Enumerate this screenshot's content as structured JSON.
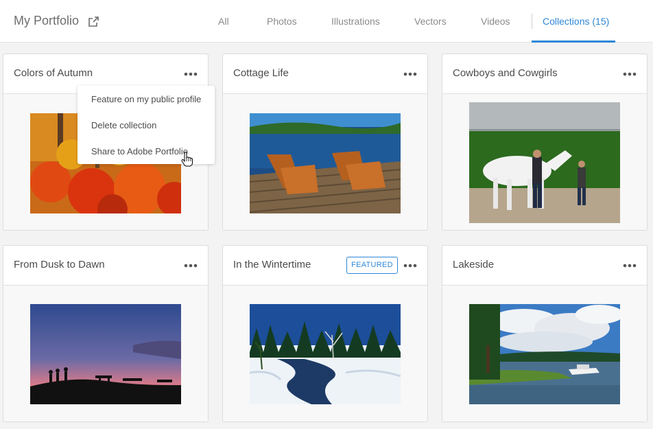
{
  "header": {
    "title": "My Portfolio",
    "external_icon": "external-link-icon",
    "tabs": [
      {
        "label": "All",
        "active": false
      },
      {
        "label": "Photos",
        "active": false
      },
      {
        "label": "Illustrations",
        "active": false
      },
      {
        "label": "Vectors",
        "active": false
      },
      {
        "label": "Videos",
        "active": false
      },
      {
        "label": "Collections (15)",
        "active": true
      }
    ]
  },
  "collections": [
    {
      "title": "Colors of Autumn",
      "featured": false,
      "thumbnail": "autumn-foliage-photo"
    },
    {
      "title": "Cottage Life",
      "featured": false,
      "thumbnail": "dock-chairs-lake-photo"
    },
    {
      "title": "Cowboys and Cowgirls",
      "featured": false,
      "thumbnail": "white-horse-cowboys-photo"
    },
    {
      "title": "From Dusk to Dawn",
      "featured": false,
      "thumbnail": "dusk-silhouettes-photo"
    },
    {
      "title": "In the Wintertime",
      "featured": true,
      "featured_label": "FEATURED",
      "thumbnail": "winter-creek-photo"
    },
    {
      "title": "Lakeside",
      "featured": false,
      "thumbnail": "lakeside-boat-photo"
    }
  ],
  "context_menu": {
    "items": [
      {
        "label": "Feature on my public profile"
      },
      {
        "label": "Delete collection"
      },
      {
        "label": "Share to Adobe Portfolio"
      }
    ]
  },
  "colors": {
    "accent": "#2d87d8",
    "background": "#f3f3f3"
  }
}
